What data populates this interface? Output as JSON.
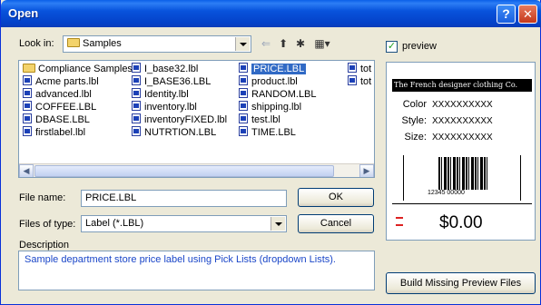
{
  "window": {
    "title": "Open",
    "help_glyph": "?",
    "close_glyph": "✕"
  },
  "look_in": {
    "label": "Look in:",
    "value": "Samples"
  },
  "files": {
    "col1": [
      "Compliance Samples",
      "Acme parts.lbl",
      "advanced.lbl",
      "COFFEE.LBL",
      "DBASE.LBL",
      "firstlabel.lbl"
    ],
    "col2": [
      "I_base32.lbl",
      "I_BASE36.LBL",
      "Identity.lbl",
      "inventory.lbl",
      "inventoryFIXED.lbl",
      "NUTRTION.LBL"
    ],
    "col3": [
      "PRICE.LBL",
      "product.lbl",
      "RANDOM.LBL",
      "shipping.lbl",
      "test.lbl",
      "TIME.LBL"
    ],
    "col4": [
      "tot",
      "tot"
    ]
  },
  "file_name": {
    "label": "File name:",
    "value": "PRICE.LBL"
  },
  "files_of_type": {
    "label": "Files of type:",
    "value": "Label (*.LBL)"
  },
  "buttons": {
    "ok": "OK",
    "cancel": "Cancel",
    "build": "Build Missing Preview Files"
  },
  "description": {
    "label": "Description",
    "text": "Sample department store price label using Pick Lists (dropdown Lists)."
  },
  "preview": {
    "checkbox_label": "preview",
    "checked": true,
    "header": "The French designer clothing Co.",
    "color_label": "Color",
    "style_label": "Style:",
    "size_label": "Size:",
    "placeholder": "XXXXXXXXXX",
    "barcode_number": "12345  00000",
    "price": "$0.00"
  },
  "colors": {
    "selection": "#316ac5",
    "description_text": "#1a46c8",
    "title_bar": "#0853dc"
  }
}
